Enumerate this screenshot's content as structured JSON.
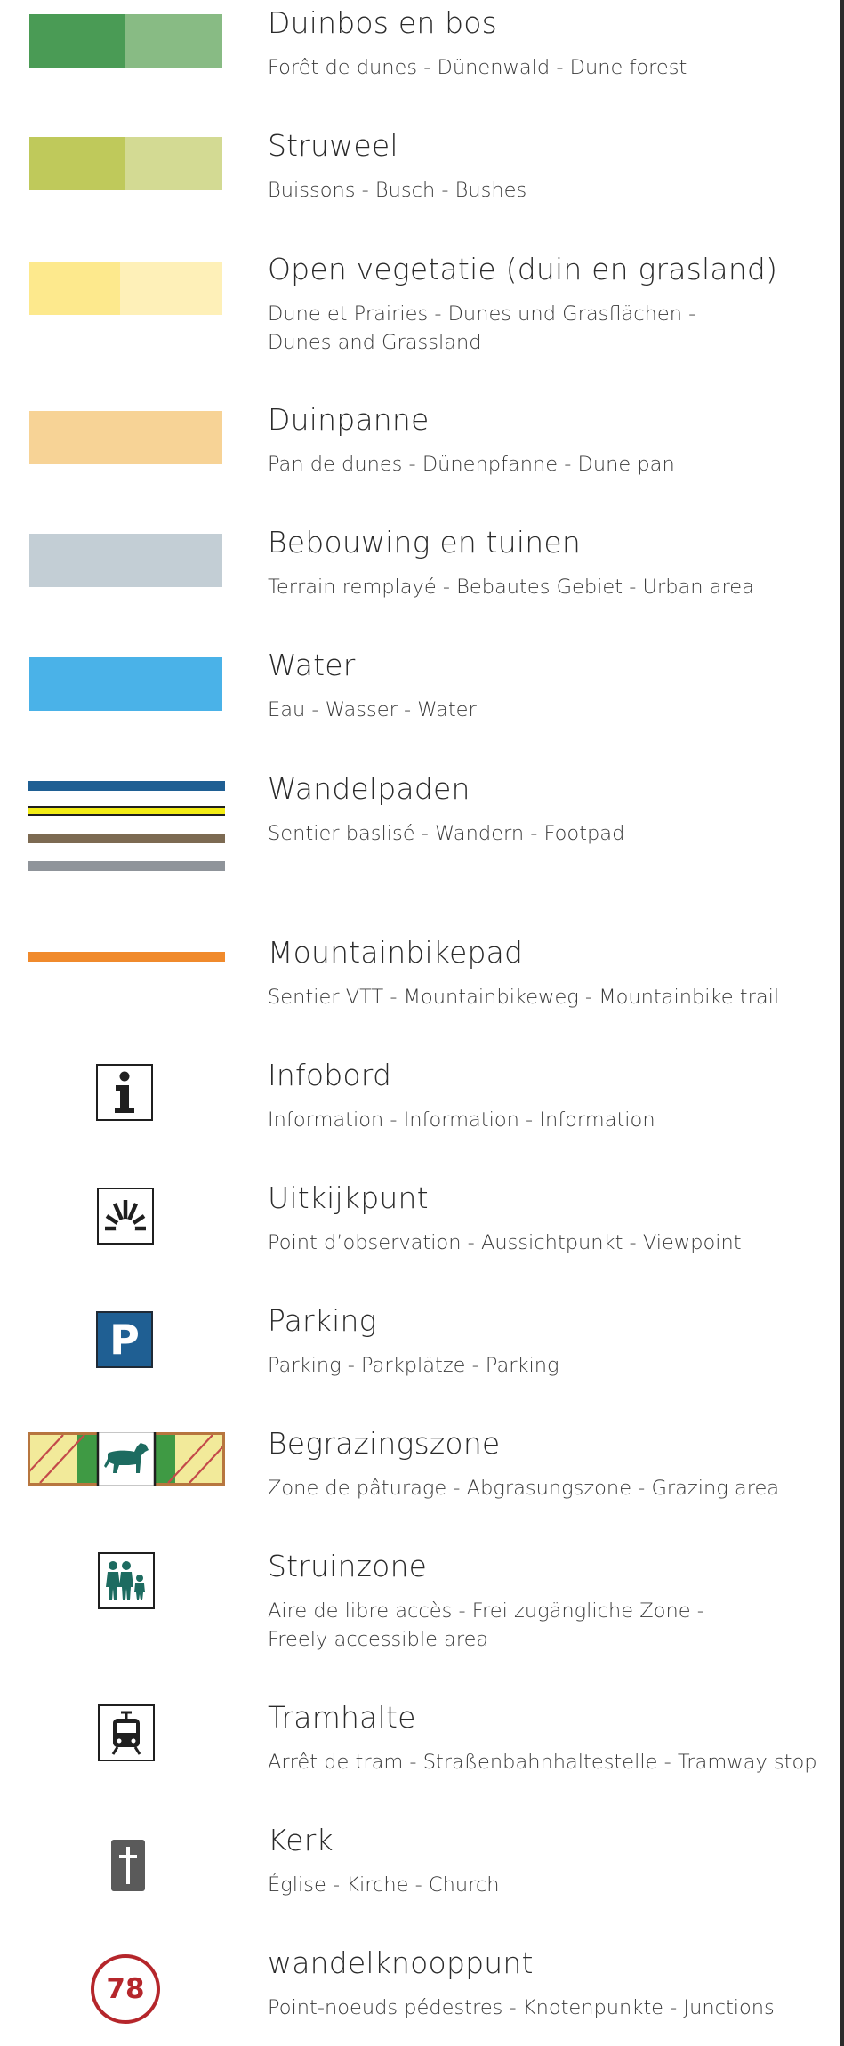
{
  "legend": {
    "items": [
      {
        "title": "Duinbos en bos",
        "subtitle": "Forêt de dunes - Dünenwald - Dune forest",
        "color_dark": "#4a9b55",
        "color_light": "#88bb84"
      },
      {
        "title": "Struweel",
        "subtitle": "Buissons - Busch - Bushes",
        "color_dark": "#bfc95b",
        "color_light": "#d3da93"
      },
      {
        "title": "Open vegetatie (duin en grasland)",
        "subtitle": "Dune et Prairies - Dunes und Grasflächen -\nDunes and Grassland",
        "color_dark": "#fde98d",
        "color_light": "#fef0b8"
      },
      {
        "title": "Duinpanne",
        "subtitle": "Pan de dunes - Dünenpfanne - Dune pan",
        "color": "#f7d396"
      },
      {
        "title": "Bebouwing en tuinen",
        "subtitle": "Terrain remplayé - Bebautes Gebiet - Urban area",
        "color": "#c3ced5"
      },
      {
        "title": "Water",
        "subtitle": "Eau - Wasser - Water",
        "color": "#4ab2e8"
      },
      {
        "title": "Wandelpaden",
        "subtitle": "Sentier baslisé - Wandern - Footpad",
        "line_colors": [
          "#1f5f93",
          "#f2ec16",
          "#7c6a52",
          "#8f949a"
        ]
      },
      {
        "title": "Mountainbikepad",
        "subtitle": "Sentier VTT - Mountainbikeweg - Mountainbike trail",
        "line_color": "#f08a2c"
      },
      {
        "title": "Infobord",
        "subtitle": "Information - Information - Information",
        "icon": "info-icon"
      },
      {
        "title": "Uitkijkpunt",
        "subtitle": "Point d’observation - Aussichtpunkt - Viewpoint",
        "icon": "viewpoint-icon"
      },
      {
        "title": "Parking",
        "subtitle": "Parking - Parkplätze - Parking",
        "icon": "parking-icon",
        "icon_letter": "P",
        "color": "#1f5f93"
      },
      {
        "title": "Begrazingszone",
        "subtitle": "Zone de pâturage - Abgrasungszone - Grazing area",
        "icon": "grazing-horse-icon"
      },
      {
        "title": "Struinzone",
        "subtitle": "Aire de libre accès - Frei zugängliche Zone -\nFreely accessible area",
        "icon": "family-walking-icon"
      },
      {
        "title": "Tramhalte",
        "subtitle": "Arrêt de tram - Straßenbahnhaltestelle - Tramway stop",
        "icon": "tram-icon"
      },
      {
        "title": "Kerk",
        "subtitle": "Église - Kirche - Church",
        "icon": "church-cross-icon"
      },
      {
        "title": "wandelknooppunt",
        "subtitle": "Point-noeuds pédestres - Knotenpunkte - Junctions",
        "icon": "junction-node-icon",
        "node_number": "78",
        "color": "#b5262b"
      }
    ]
  }
}
